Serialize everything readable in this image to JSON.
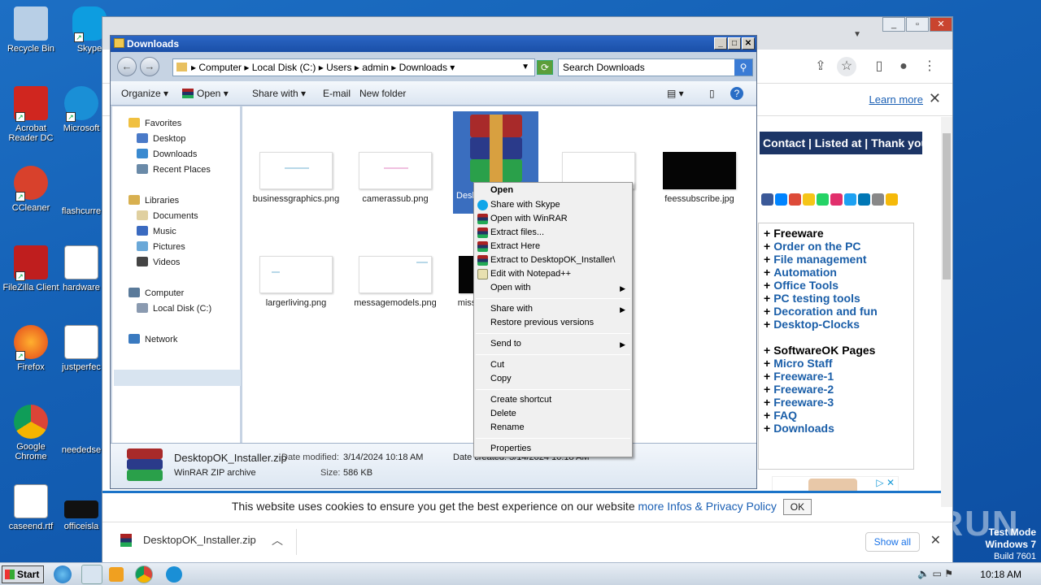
{
  "desktop": {
    "icons": [
      {
        "label": "Recycle Bin",
        "color": "#b8cfe6"
      },
      {
        "label": "Acrobat Reader DC",
        "color": "#d0261f"
      },
      {
        "label": "CCleaner",
        "color": "#d8412c"
      },
      {
        "label": "FileZilla Client",
        "color": "#bf1e1e"
      },
      {
        "label": "Firefox",
        "color": "#ff7a1c"
      },
      {
        "label": "Google Chrome",
        "color": "#2e8be0"
      },
      {
        "label": "caseend.rtf",
        "color": "#ffffff"
      }
    ],
    "icons2": [
      {
        "label": "Skype",
        "color": "#0d9de0"
      },
      {
        "label": "Microsoft",
        "color": "#1a8fd6"
      },
      {
        "label": "flashcurre",
        "color": "#1560b5"
      },
      {
        "label": "hardware",
        "color": "#ffffff"
      },
      {
        "label": "justperfec",
        "color": "#ffffff"
      },
      {
        "label": "neededse",
        "color": "#1560b5"
      },
      {
        "label": "officeisla",
        "color": "#111111"
      }
    ]
  },
  "browser": {
    "infobar_learn": "Learn more",
    "site_nav": "Contact | Listed at | Thank you",
    "menu1_title": "Freeware",
    "menu1": [
      "Order on the PC",
      "File management",
      "Automation",
      "Office Tools",
      "PC testing tools",
      "Decoration and fun",
      "Desktop-Clocks"
    ],
    "menu2_title": "SoftwareOK Pages",
    "menu2": [
      "Micro Staff",
      "Freeware-1",
      "Freeware-2",
      "Freeware-3",
      "FAQ",
      "Downloads"
    ],
    "cookie_text": "This website uses cookies to ensure you get the best experience on our website",
    "cookie_link": "more Infos & Privacy Policy",
    "cookie_ok": "OK",
    "download_file": "DesktopOK_Installer.zip",
    "show_all": "Show all",
    "social_colors": [
      "#3b5998",
      "#0084ff",
      "#dd4b39",
      "#f5c518",
      "#25d366",
      "#e1306c",
      "#1da1f2",
      "#0077b5",
      "#888888",
      "#f5b90a"
    ]
  },
  "explorer": {
    "title": "Downloads",
    "breadcrumb": [
      "Computer",
      "Local Disk (C:)",
      "Users",
      "admin",
      "Downloads"
    ],
    "search_placeholder": "Search Downloads",
    "commands": {
      "organize": "Organize",
      "open": "Open",
      "share_with": "Share with",
      "email": "E-mail",
      "new_folder": "New folder"
    },
    "nav": {
      "favorites": "Favorites",
      "desktop": "Desktop",
      "downloads": "Downloads",
      "recent": "Recent Places",
      "libraries": "Libraries",
      "documents": "Documents",
      "music": "Music",
      "pictures": "Pictures",
      "videos": "Videos",
      "computer": "Computer",
      "local_disk": "Local Disk (C:)",
      "network": "Network"
    },
    "files": {
      "f1": "businessgraphics.png",
      "f2": "camerassub.png",
      "f3": "Desk",
      "f5": "feessubscribe.jpg",
      "f6": "largerliving.png",
      "f7": "messagemodels.png",
      "f8": "miss"
    },
    "details": {
      "name": "DesktopOK_Installer.zip",
      "modified_label": "Date modified:",
      "modified": "3/14/2024 10:18 AM",
      "created": "Date created: 3/14/2024 10:18 AM",
      "type": "WinRAR ZIP archive",
      "size_label": "Size:",
      "size": "586 KB"
    }
  },
  "context_menu": {
    "open": "Open",
    "skype": "Share with Skype",
    "open_winrar": "Open with WinRAR",
    "extract_files": "Extract files...",
    "extract_here": "Extract Here",
    "extract_to": "Extract to DesktopOK_Installer\\",
    "notepad": "Edit with Notepad++",
    "open_with": "Open with",
    "share_with": "Share with",
    "restore": "Restore previous versions",
    "send_to": "Send to",
    "cut": "Cut",
    "copy": "Copy",
    "shortcut": "Create shortcut",
    "delete": "Delete",
    "rename": "Rename",
    "properties": "Properties"
  },
  "taskbar": {
    "start": "Start",
    "time": "10:18 AM"
  },
  "watermark": {
    "line1": "Test Mode",
    "line2": "Windows 7",
    "line3": "Build 7601",
    "brand": "ANY RUN"
  }
}
